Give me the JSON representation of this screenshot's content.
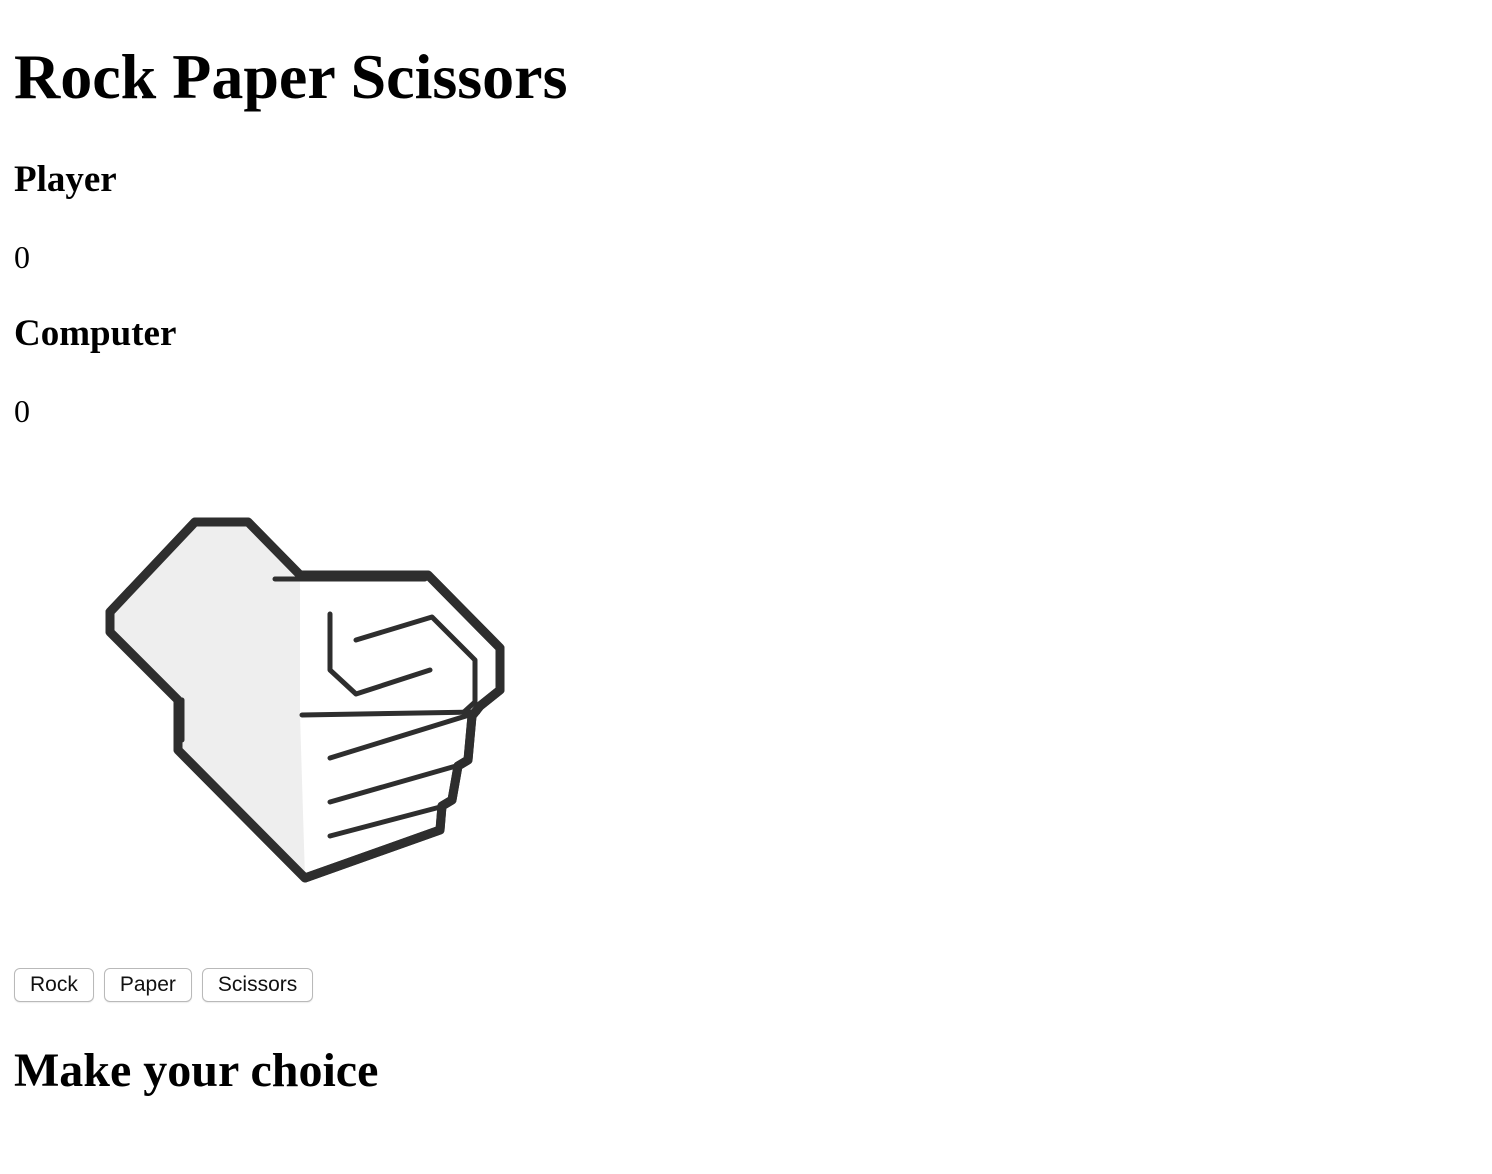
{
  "title": "Rock Paper Scissors",
  "player": {
    "label": "Player",
    "score": "0"
  },
  "computer": {
    "label": "Computer",
    "score": "0"
  },
  "hands": {
    "player_choice": "rock-fist-icon",
    "computer_choice": "rock-fist-icon"
  },
  "buttons": {
    "rock": "Rock",
    "paper": "Paper",
    "scissors": "Scissors"
  },
  "result_message": "Make your choice",
  "colors": {
    "outline": "#2e2e2e",
    "shade": "#eeeeee",
    "fill": "#ffffff"
  }
}
